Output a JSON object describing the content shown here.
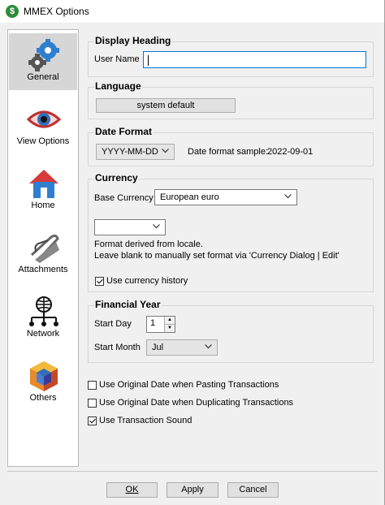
{
  "window": {
    "title": "MMEX Options",
    "app_icon": "mmex-app-icon"
  },
  "sidebar": {
    "items": [
      {
        "label": "General",
        "icon": "gears-icon",
        "selected": true
      },
      {
        "label": "View Options",
        "icon": "eye-icon",
        "selected": false
      },
      {
        "label": "Home",
        "icon": "house-icon",
        "selected": false
      },
      {
        "label": "Attachments",
        "icon": "paperclip-icon",
        "selected": false
      },
      {
        "label": "Network",
        "icon": "network-icon",
        "selected": false
      },
      {
        "label": "Others",
        "icon": "cube-icon",
        "selected": false
      }
    ]
  },
  "display_heading": {
    "title": "Display Heading",
    "user_name_label": "User Name",
    "user_name_value": ""
  },
  "language": {
    "title": "Language",
    "button_label": "system default"
  },
  "date_format": {
    "title": "Date Format",
    "selected": "YYYY-MM-DD",
    "sample_label": "Date format sample:",
    "sample_value": "2022-09-01"
  },
  "currency": {
    "title": "Currency",
    "base_label": "Base Currency",
    "base_value": "European euro",
    "format_value": "",
    "note_line1": "Format derived from locale.",
    "note_line2": "Leave blank to manually set format via 'Currency Dialog | Edit'",
    "history_label": "Use currency history",
    "history_checked": true
  },
  "financial_year": {
    "title": "Financial Year",
    "start_day_label": "Start Day",
    "start_day_value": "1",
    "start_month_label": "Start Month",
    "start_month_value": "Jul"
  },
  "options": [
    {
      "label": "Use Original Date when Pasting Transactions",
      "checked": false
    },
    {
      "label": "Use Original Date when Duplicating Transactions",
      "checked": false
    },
    {
      "label": "Use Transaction Sound",
      "checked": true
    }
  ],
  "buttons": {
    "ok": "OK",
    "apply": "Apply",
    "cancel": "Cancel"
  },
  "colors": {
    "accent": "#0078d7",
    "selected_bg": "#d6d6d6",
    "window_bg": "#f0f0f0"
  }
}
